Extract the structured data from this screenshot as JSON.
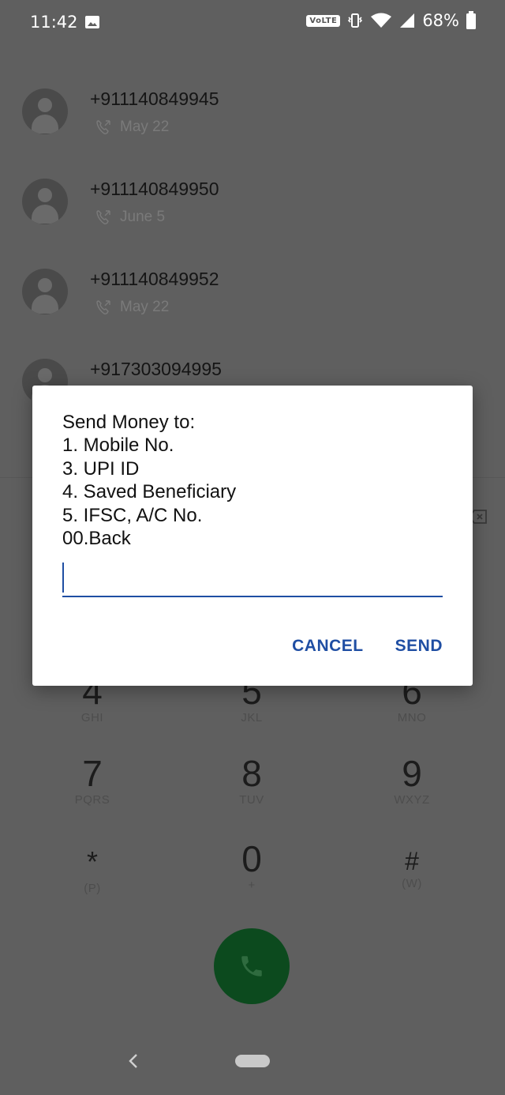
{
  "status_bar": {
    "time": "11:42",
    "volte": "VoLTE",
    "battery": "68%"
  },
  "call_log": [
    {
      "number": "+911140849945",
      "date": "May 22"
    },
    {
      "number": "+911140849950",
      "date": "June 5"
    },
    {
      "number": "+911140849952",
      "date": "May 22"
    },
    {
      "number": "+917303094995",
      "date": ""
    }
  ],
  "dialpad": {
    "keys": [
      {
        "digit": "4",
        "letters": "GHI"
      },
      {
        "digit": "5",
        "letters": "JKL"
      },
      {
        "digit": "6",
        "letters": "MNO"
      },
      {
        "digit": "7",
        "letters": "PQRS"
      },
      {
        "digit": "8",
        "letters": "TUV"
      },
      {
        "digit": "9",
        "letters": "WXYZ"
      },
      {
        "digit": "*",
        "letters": "(P)"
      },
      {
        "digit": "0",
        "letters": "+"
      },
      {
        "digit": "#",
        "letters": "(W)"
      }
    ]
  },
  "dialog": {
    "message": "Send Money to:\n1. Mobile No.\n3. UPI ID\n4. Saved Beneficiary\n5. IFSC, A/C No.\n00.Back",
    "input_value": "",
    "cancel_label": "CANCEL",
    "send_label": "SEND",
    "accent_color": "#1f4ea3"
  },
  "colors": {
    "scrim_background": "#5f5f5f",
    "call_button": "#0c4a1e"
  }
}
